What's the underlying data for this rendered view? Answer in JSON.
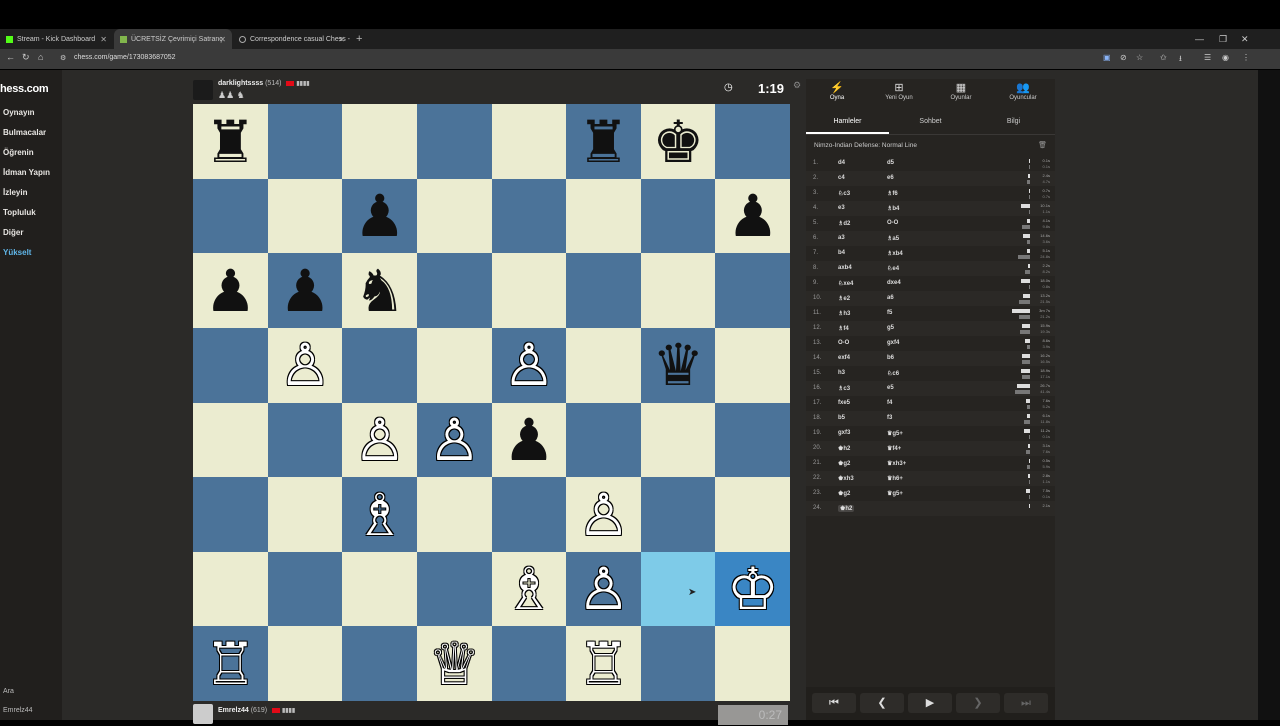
{
  "browser": {
    "tabs": [
      {
        "label": "Stream - Kick Dashboard"
      },
      {
        "label": "ÜCRETSİZ Çevrimiçi Satranç"
      },
      {
        "label": "Correspondence casual Chess -"
      }
    ],
    "url": "chess.com/game/173083687052"
  },
  "sidebar": {
    "logo": "hess.com",
    "items": [
      {
        "label": "Oynayın"
      },
      {
        "label": "Bulmacalar"
      },
      {
        "label": "Öğrenin"
      },
      {
        "label": "İdman Yapın"
      },
      {
        "label": "İzleyin"
      },
      {
        "label": "Topluluk"
      },
      {
        "label": "Diğer"
      },
      {
        "label": "Yükselt"
      }
    ],
    "search_label": "Ara",
    "user_label": "Emrelz44"
  },
  "top_player": {
    "name": "darklightssss",
    "rating": "(514)",
    "captured": "♟♟ ♞",
    "clock": "1:19"
  },
  "bottom_player": {
    "name": "Emrelz44",
    "rating": "(619)",
    "clock": "0:27"
  },
  "board": {
    "pieces": [
      "♜",
      "",
      "",
      "",
      "",
      "♜",
      "♚",
      "",
      "",
      "",
      "♟",
      "",
      "",
      "",
      "",
      "♟",
      "♟",
      "♟",
      "♞",
      "",
      "",
      "",
      "",
      "",
      "",
      "♙",
      "",
      "",
      "♙",
      "",
      "♛",
      "",
      "",
      "",
      "♙",
      "♙",
      "♟",
      "",
      "",
      "",
      "",
      "",
      "♗",
      "",
      "",
      "♙",
      "",
      "",
      "",
      "",
      "",
      "",
      "♗",
      "♙",
      "",
      "♔",
      "♖",
      "",
      "",
      "♕",
      "",
      "♖",
      "",
      ""
    ],
    "colors": [
      "b",
      "",
      "",
      "",
      "",
      "b",
      "b",
      "",
      "",
      "",
      "b",
      "",
      "",
      "",
      "",
      "b",
      "b",
      "b",
      "b",
      "",
      "",
      "",
      "",
      "",
      "",
      "w",
      "",
      "",
      "w",
      "",
      "b",
      "",
      "",
      "",
      "w",
      "w",
      "b",
      "",
      "",
      "",
      "",
      "",
      "w",
      "",
      "",
      "w",
      "",
      "",
      "",
      "",
      "",
      "",
      "w",
      "w",
      "",
      "w",
      "w",
      "",
      "",
      "w",
      "",
      "w",
      "",
      ""
    ],
    "highlight_from": 54,
    "highlight_to": 55
  },
  "panel": {
    "top_tabs": [
      {
        "label": "Oyna",
        "icon": "⚡"
      },
      {
        "label": "Yeni Oyun",
        "icon": "⊞"
      },
      {
        "label": "Oyunlar",
        "icon": "▦"
      },
      {
        "label": "Oyuncular",
        "icon": "👥"
      }
    ],
    "sub_tabs": [
      {
        "label": "Hamleler"
      },
      {
        "label": "Sohbet"
      },
      {
        "label": "Bilgi"
      }
    ],
    "opening": "Nimzo-Indian Defense: Normal Line",
    "moves": [
      {
        "n": "1.",
        "w": "d4",
        "b": "d5",
        "tw": "0.1s",
        "tb": "0.1s",
        "ww": 1,
        "wb": 1
      },
      {
        "n": "2.",
        "w": "c4",
        "b": "e6",
        "tw": "2.4s",
        "tb": "4.7s",
        "ww": 2,
        "wb": 3
      },
      {
        "n": "3.",
        "w": "♘c3",
        "b": "♗f6",
        "tw": "0.7s",
        "tb": "0.7s",
        "ww": 1,
        "wb": 1
      },
      {
        "n": "4.",
        "w": "e3",
        "b": "♗b4",
        "tw": "10.1s",
        "tb": "1.1s",
        "ww": 9,
        "wb": 1
      },
      {
        "n": "5.",
        "w": "♗d2",
        "b": "O-O",
        "tw": "4.1s",
        "tb": "9.8s",
        "ww": 3,
        "wb": 8
      },
      {
        "n": "6.",
        "w": "a3",
        "b": "♗a5",
        "tw": "14.6s",
        "tb": "3.6s",
        "ww": 7,
        "wb": 3
      },
      {
        "n": "7.",
        "w": "b4",
        "b": "♗xb4",
        "tw": "5.1s",
        "tb": "24.8s",
        "ww": 3,
        "wb": 12
      },
      {
        "n": "8.",
        "w": "axb4",
        "b": "♘e4",
        "tw": "2.2s",
        "tb": "8.2s",
        "ww": 2,
        "wb": 5
      },
      {
        "n": "9.",
        "w": "♘xe4",
        "b": "dxe4",
        "tw": "18.0s",
        "tb": "0.8s",
        "ww": 9,
        "wb": 1
      },
      {
        "n": "10.",
        "w": "♗e2",
        "b": "a6",
        "tw": "13.2s",
        "tb": "21.5s",
        "ww": 7,
        "wb": 11
      },
      {
        "n": "11.",
        "w": "♗h3",
        "b": "f5",
        "tw": "3m 7s",
        "tb": "21.2s",
        "ww": 18,
        "wb": 11
      },
      {
        "n": "12.",
        "w": "♗f4",
        "b": "g5",
        "tw": "15.9s",
        "tb": "19.3s",
        "ww": 8,
        "wb": 10
      },
      {
        "n": "13.",
        "w": "O-O",
        "b": "gxf4",
        "tw": "8.6s",
        "tb": "3.9s",
        "ww": 5,
        "wb": 3
      },
      {
        "n": "14.",
        "w": "exf4",
        "b": "b6",
        "tw": "16.2s",
        "tb": "16.5s",
        "ww": 8,
        "wb": 8
      },
      {
        "n": "15.",
        "w": "h3",
        "b": "♘c6",
        "tw": "18.9s",
        "tb": "17.1s",
        "ww": 9,
        "wb": 8
      },
      {
        "n": "16.",
        "w": "♗c3",
        "b": "e5",
        "tw": "26.7s",
        "tb": "41.4s",
        "ww": 13,
        "wb": 15
      },
      {
        "n": "17.",
        "w": "fxe5",
        "b": "f4",
        "tw": "7.6s",
        "tb": "5.2s",
        "ww": 4,
        "wb": 3
      },
      {
        "n": "18.",
        "w": "b5",
        "b": "f3",
        "tw": "6.1s",
        "tb": "11.8s",
        "ww": 3,
        "wb": 6
      },
      {
        "n": "19.",
        "w": "gxf3",
        "b": "♛g5+",
        "tw": "11.2s",
        "tb": "0.1s",
        "ww": 6,
        "wb": 1
      },
      {
        "n": "20.",
        "w": "♚h2",
        "b": "♛f4+",
        "tw": "3.1s",
        "tb": "7.6s",
        "ww": 2,
        "wb": 4
      },
      {
        "n": "21.",
        "w": "♚g2",
        "b": "♛xh3+",
        "tw": "0.5s",
        "tb": "5.9s",
        "ww": 1,
        "wb": 3
      },
      {
        "n": "22.",
        "w": "♚xh3",
        "b": "♛h6+",
        "tw": "2.8s",
        "tb": "1.1s",
        "ww": 2,
        "wb": 1
      },
      {
        "n": "23.",
        "w": "♚g2",
        "b": "♛g5+",
        "tw": "7.5s",
        "tb": "0.1s",
        "ww": 4,
        "wb": 1
      },
      {
        "n": "24.",
        "w": "♚h2",
        "b": "",
        "tw": "2.1s",
        "tb": "",
        "ww": 1,
        "wb": 0
      }
    ],
    "controls": [
      "⏮",
      "❮",
      "▶",
      "❯",
      "⏭"
    ]
  },
  "colors": {
    "light_square": "#ebecd0",
    "dark_square": "#4b7399",
    "highlight_light": "#7ecbe8",
    "highlight_dark": "#3a86c4"
  }
}
